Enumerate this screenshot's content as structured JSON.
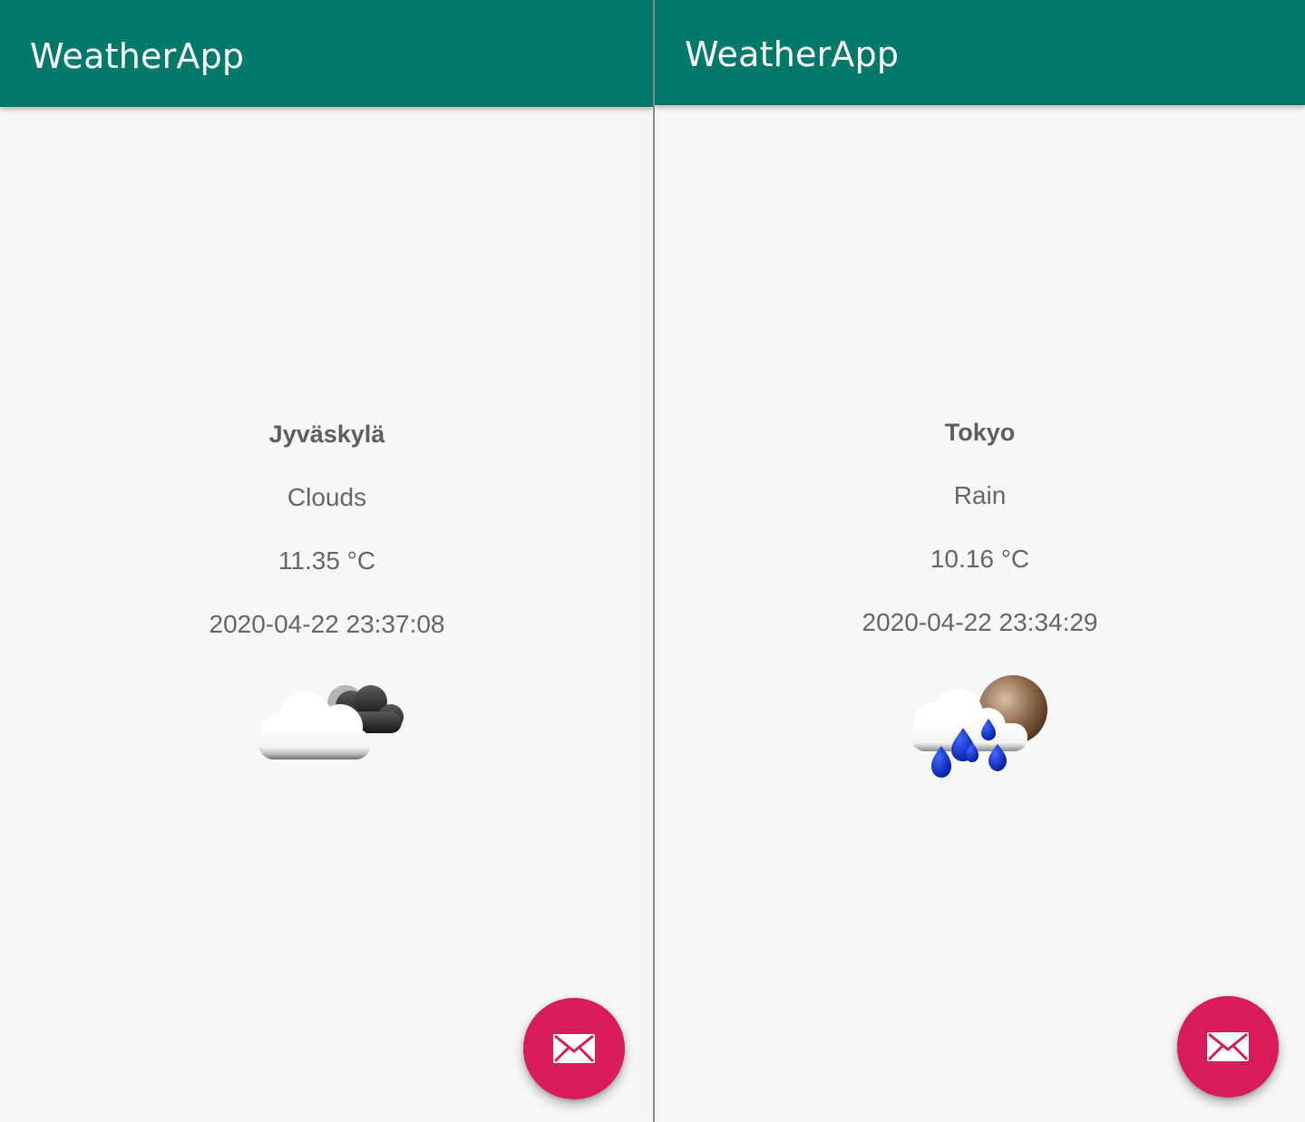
{
  "screens": [
    {
      "app_title": "WeatherApp",
      "city": "Jyväskylä",
      "condition": "Clouds",
      "temperature": "11.35 °C",
      "timestamp": "2020-04-22 23:37:08",
      "weather_icon": "night-clouds-icon",
      "fab_icon": "mail-icon"
    },
    {
      "app_title": "WeatherApp",
      "city": "Tokyo",
      "condition": "Rain",
      "temperature": "10.16 °C",
      "timestamp": "2020-04-22 23:34:29",
      "weather_icon": "night-rain-icon",
      "fab_icon": "mail-icon"
    }
  ],
  "colors": {
    "app_bar": "#00796b",
    "fab": "#d81b5a",
    "background": "#f7f7f7",
    "text": "#666666"
  }
}
